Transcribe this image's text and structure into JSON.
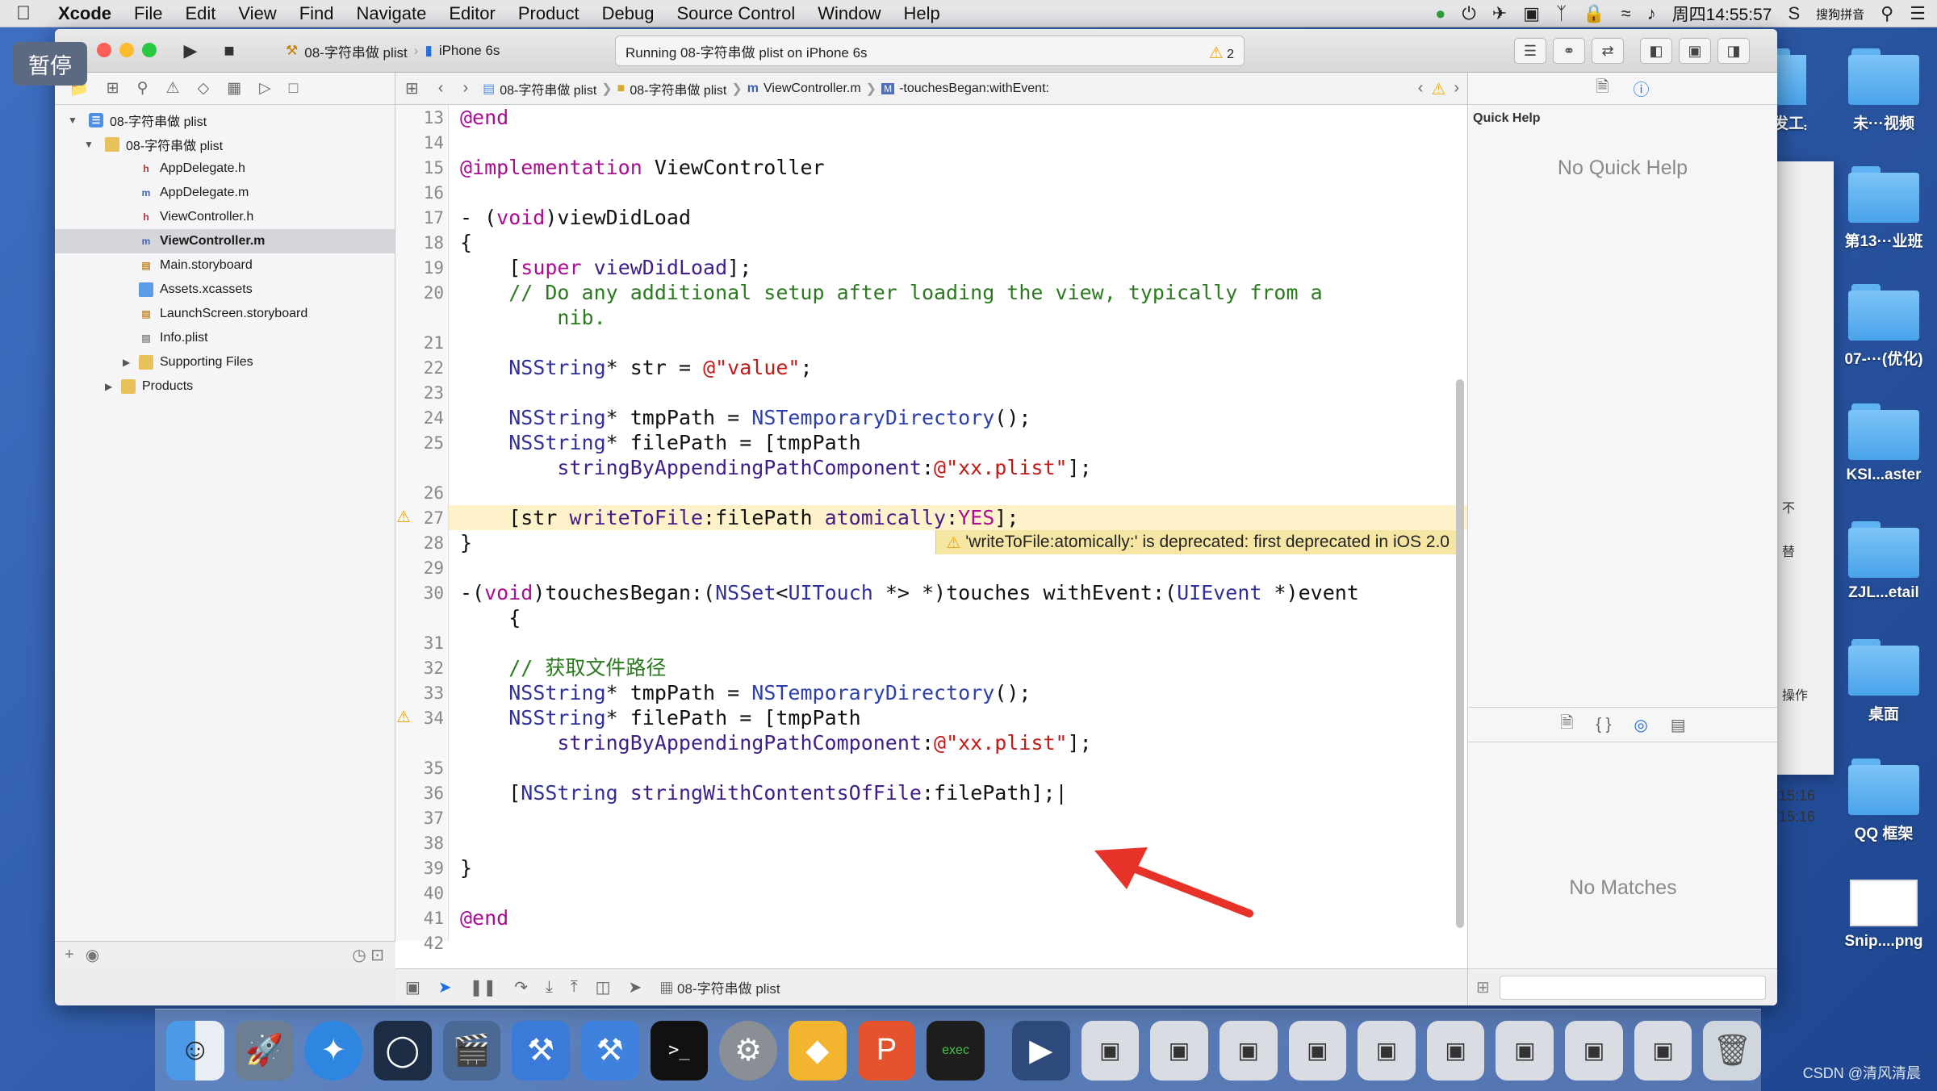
{
  "menubar": {
    "app": "Xcode",
    "items": [
      "File",
      "Edit",
      "View",
      "Find",
      "Navigate",
      "Editor",
      "Product",
      "Debug",
      "Source Control",
      "Window",
      "Help"
    ],
    "ime": "搜狗拼音",
    "clock": "周四14:55:57"
  },
  "pause_badge": "暂停",
  "toolbar": {
    "scheme": "08-字符串做 plist",
    "device": "iPhone 6s",
    "status": "Running 08-字符串做 plist on iPhone 6s",
    "warning_count": "2"
  },
  "navigator": {
    "items": [
      {
        "label": "08-字符串做 plist",
        "icon": "project-icon"
      },
      {
        "label": "08-字符串做 plist",
        "icon": "folder-icon"
      },
      {
        "label": "AppDelegate.h",
        "icon": "h"
      },
      {
        "label": "AppDelegate.m",
        "icon": "m"
      },
      {
        "label": "ViewController.h",
        "icon": "h"
      },
      {
        "label": "ViewController.m",
        "icon": "m",
        "selected": true
      },
      {
        "label": "Main.storyboard",
        "icon": "storyboard-icon"
      },
      {
        "label": "Assets.xcassets",
        "icon": "folder-icon"
      },
      {
        "label": "LaunchScreen.storyboard",
        "icon": "storyboard-icon"
      },
      {
        "label": "Info.plist",
        "icon": "plist-icon"
      },
      {
        "label": "Supporting Files",
        "icon": "folder-icon"
      },
      {
        "label": "Products",
        "icon": "folder-icon"
      }
    ]
  },
  "jumpbar": {
    "crumbs": [
      "08-字符串做 plist",
      "08-字符串做 plist",
      "ViewController.m",
      "-touchesBegan:withEvent:"
    ]
  },
  "editor": {
    "line_numbers": [
      "13",
      "14",
      "15",
      "16",
      "17",
      "18",
      "19",
      "20",
      "",
      "21",
      "22",
      "23",
      "24",
      "25",
      "",
      "26",
      "27",
      "28",
      "29",
      "30",
      "",
      "31",
      "32",
      "33",
      "34",
      "",
      "35",
      "36",
      "37",
      "38",
      "39",
      "40",
      "41",
      "42"
    ],
    "warning_message": "'writeToFile:atomically:' is deprecated: first deprecated in iOS 2.0"
  },
  "debugbar": {
    "target": "08-字符串做 plist"
  },
  "inspector": {
    "title": "Quick Help",
    "empty": "No Quick Help",
    "no_matches": "No Matches"
  },
  "desktop": {
    "labels": [
      "开发工具",
      "未···视频",
      "第13···业班",
      "07-···(优化)",
      "KSI...aster",
      "ZJL...etail",
      "桌面",
      "QQ 框架",
      "Snip....png"
    ]
  },
  "background_window": {
    "labels": [
      "不",
      "替",
      "操作",
      "15:16",
      "15:16"
    ]
  },
  "watermark": "CSDN @清风清晨",
  "colors": {
    "accent": "#1f6fe0",
    "keyword": "#aa0d91",
    "string": "#c41a16",
    "comment": "#2b7a1f",
    "warning": "#f0a500",
    "highlight_line": "#fdf2c9"
  }
}
